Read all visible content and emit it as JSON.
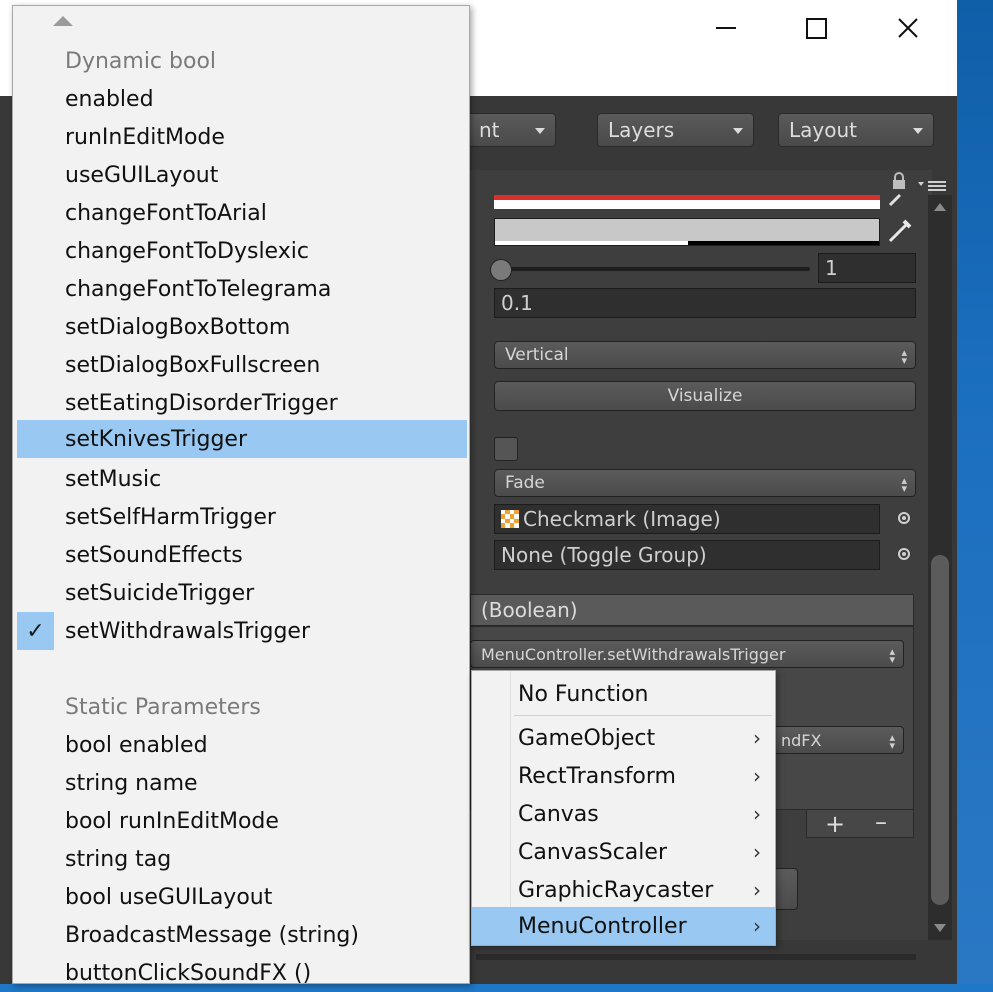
{
  "window": {
    "minimize_icon": "minimize-icon",
    "maximize_icon": "maximize-icon",
    "close_icon": "close-icon"
  },
  "toolbar": {
    "account_partial": "nt",
    "layers_label": "Layers",
    "layout_label": "Layout"
  },
  "inspector": {
    "slider_value": "1",
    "float_value": "0.1",
    "direction_value": "Vertical",
    "visualize_label": "Visualize",
    "transition_value": "Fade",
    "graphic_value": "Checkmark (Image)",
    "group_value": "None (Toggle Group)",
    "event_header": "(Boolean)",
    "function_value": "MenuController.setWithdrawalsTrigger",
    "function_value_2": "ndFX",
    "add_icon": "+",
    "remove_icon": "–"
  },
  "menu": {
    "dynamic_header": "Dynamic bool",
    "dynamic_items": [
      "enabled",
      "runInEditMode",
      "useGUILayout",
      "changeFontToArial",
      "changeFontToDyslexic",
      "changeFontToTelegrama",
      "setDialogBoxBottom",
      "setDialogBoxFullscreen",
      "setEatingDisorderTrigger",
      "setKnivesTrigger",
      "setMusic",
      "setSelfHarmTrigger",
      "setSoundEffects",
      "setSuicideTrigger",
      "setWithdrawalsTrigger"
    ],
    "highlighted": "setKnivesTrigger",
    "checked": "setWithdrawalsTrigger",
    "static_header": "Static Parameters",
    "static_items": [
      "bool enabled",
      "string name",
      "bool runInEditMode",
      "string tag",
      "bool useGUILayout",
      "BroadcastMessage (string)",
      "buttonClickSoundFX ()"
    ]
  },
  "submenu": {
    "items": [
      "No Function",
      "GameObject",
      "RectTransform",
      "Canvas",
      "CanvasScaler",
      "GraphicRaycaster",
      "MenuController"
    ],
    "highlighted": "MenuController"
  }
}
